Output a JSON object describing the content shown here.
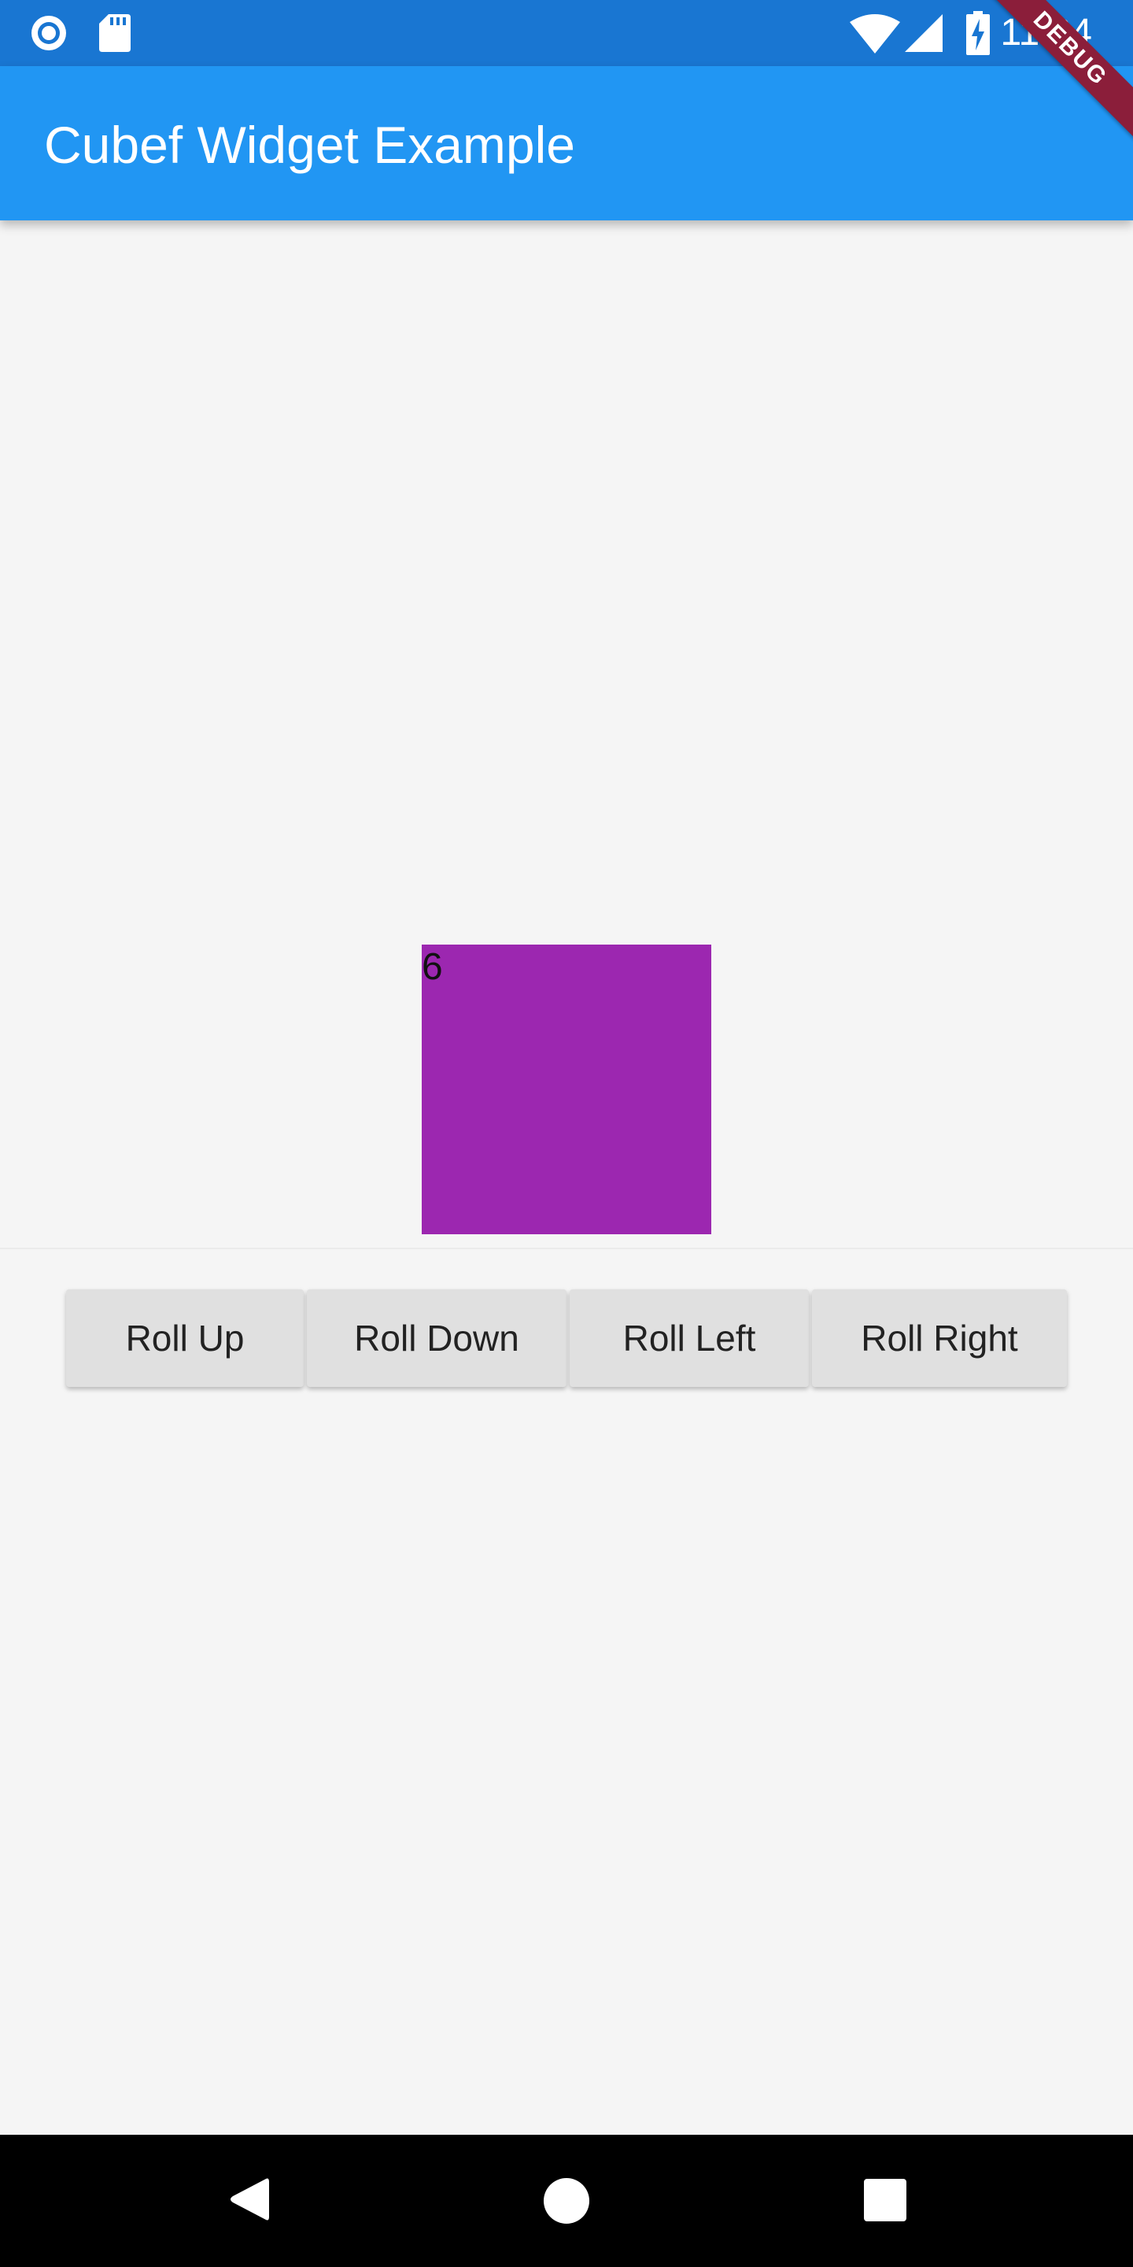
{
  "status_bar": {
    "time": "11:24",
    "left_icons": [
      "radio-icon",
      "sd-card-icon"
    ],
    "right_icons": [
      "wifi-icon",
      "signal-icon",
      "battery-charging-icon"
    ],
    "color": "#1976d2"
  },
  "app_bar": {
    "title": "Cubef Widget Example",
    "color": "#2196f3"
  },
  "debug_banner": {
    "label": "DEBUG"
  },
  "cube": {
    "face_label": "6",
    "color": "#9c27b0"
  },
  "buttons": [
    {
      "label": "Roll Up"
    },
    {
      "label": "Roll Down"
    },
    {
      "label": "Roll Left"
    },
    {
      "label": "Roll Right"
    }
  ],
  "nav_bar": {
    "icons": [
      "back-icon",
      "home-icon",
      "recents-icon"
    ]
  }
}
